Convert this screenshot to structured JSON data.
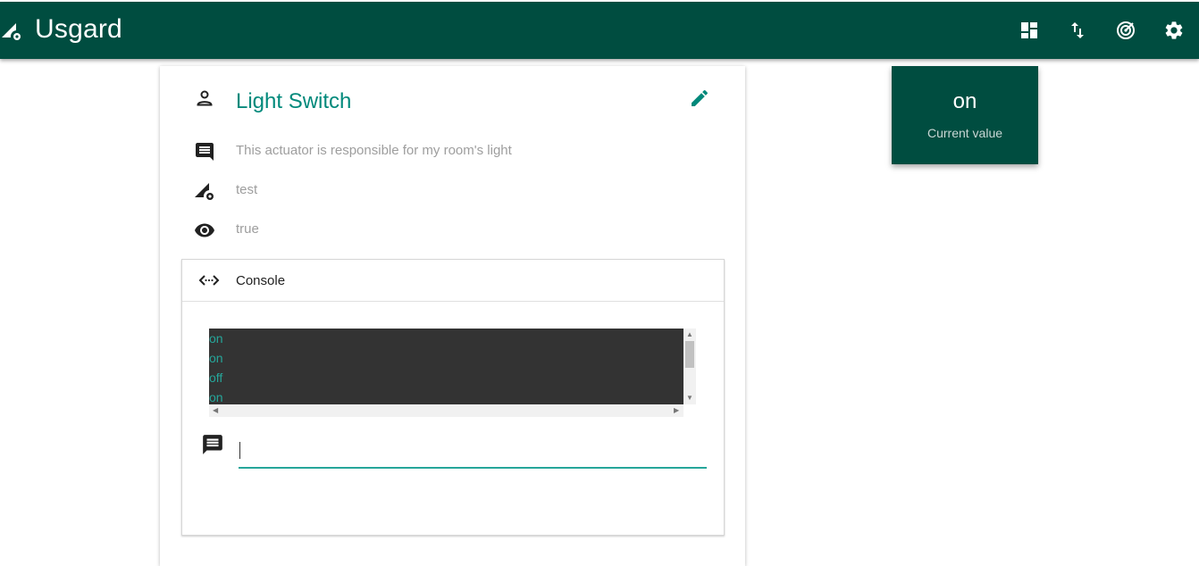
{
  "app": {
    "title": "Usgard"
  },
  "topbar": {
    "actions": [
      {
        "name": "dashboard-icon"
      },
      {
        "name": "swap-vert-icon"
      },
      {
        "name": "radar-icon"
      },
      {
        "name": "settings-icon"
      }
    ]
  },
  "device": {
    "name": "Light Switch",
    "description": "This actuator is responsible for my room's light",
    "type": "test",
    "visible": "true"
  },
  "console": {
    "title": "Console",
    "log": [
      "on",
      "on",
      "off",
      "on"
    ],
    "input_value": "",
    "accent": "#26a69a"
  },
  "current_value": {
    "value": "on",
    "label": "Current value"
  },
  "colors": {
    "primary": "#004d40",
    "accent": "#00897b",
    "log_bg": "#333333"
  }
}
